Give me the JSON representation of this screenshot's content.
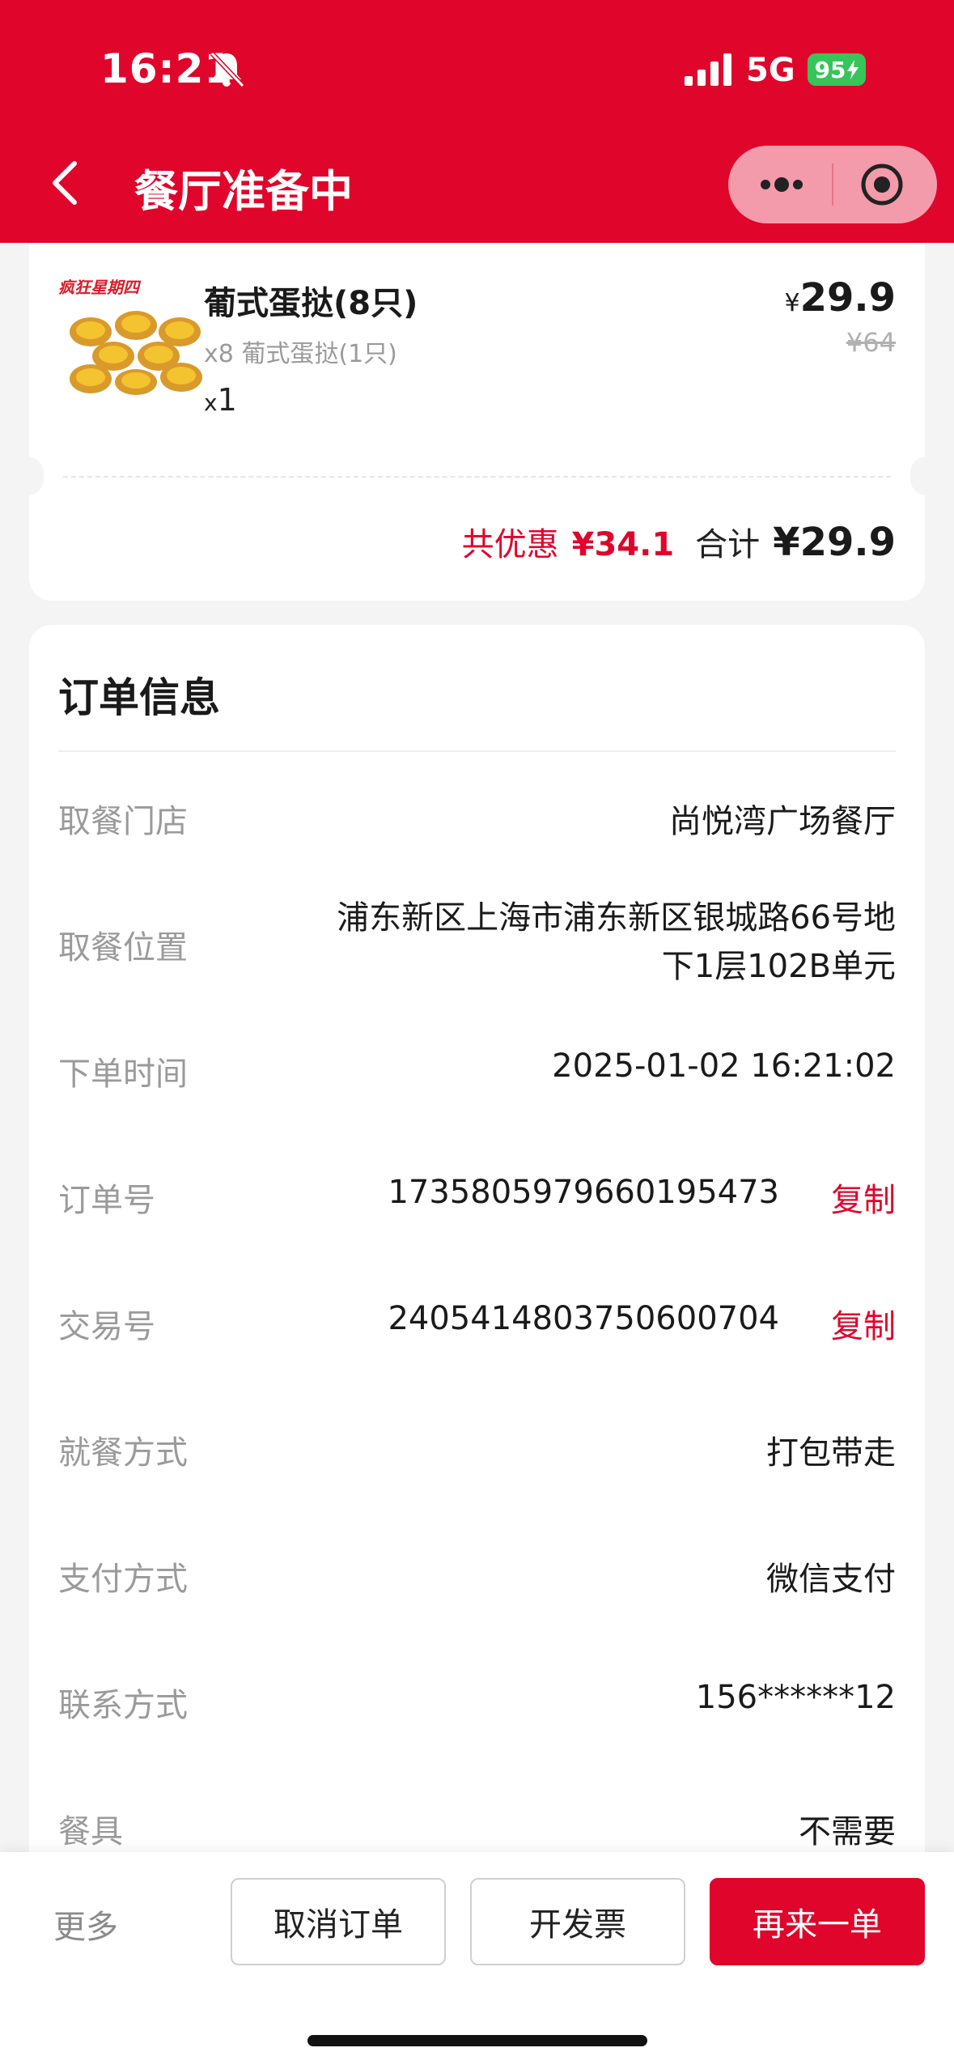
{
  "status_bar": {
    "time": "16:21",
    "network": "5G",
    "battery": "95"
  },
  "nav": {
    "title": "餐厅准备中"
  },
  "product": {
    "name": "葡式蛋挞(8只)",
    "sub": "x8 葡式蛋挞(1只)",
    "qty_prefix": "x",
    "qty": "1",
    "price_symbol": "¥",
    "price": "29.9",
    "original_price": "¥64",
    "image_label": "疯狂星期四"
  },
  "totals": {
    "discount_label": "共优惠",
    "discount_value": "¥34.1",
    "total_label": "合计",
    "total_value": "¥29.9"
  },
  "order_info": {
    "title": "订单信息",
    "rows": [
      {
        "label": "取餐门店",
        "value": "尚悦湾广场餐厅"
      },
      {
        "label": "取餐位置",
        "value_line1": "浦东新区上海市浦东新区银城路66号地",
        "value_line2": "下1层102B单元"
      },
      {
        "label": "下单时间",
        "value": "2025-01-02 16:21:02"
      },
      {
        "label": "订单号",
        "value": "1735805979660195473",
        "action": "复制"
      },
      {
        "label": "交易号",
        "value": "2405414803750600704",
        "action": "复制"
      },
      {
        "label": "就餐方式",
        "value": "打包带走"
      },
      {
        "label": "支付方式",
        "value": "微信支付"
      },
      {
        "label": "联系方式",
        "value": "156******12"
      },
      {
        "label": "餐具",
        "value": "不需要"
      }
    ]
  },
  "bottom_bar": {
    "more": "更多",
    "cancel": "取消订单",
    "invoice": "开发票",
    "reorder": "再来一单"
  },
  "colors": {
    "brand_red": "#e0052b",
    "battery_green": "#37c559"
  }
}
